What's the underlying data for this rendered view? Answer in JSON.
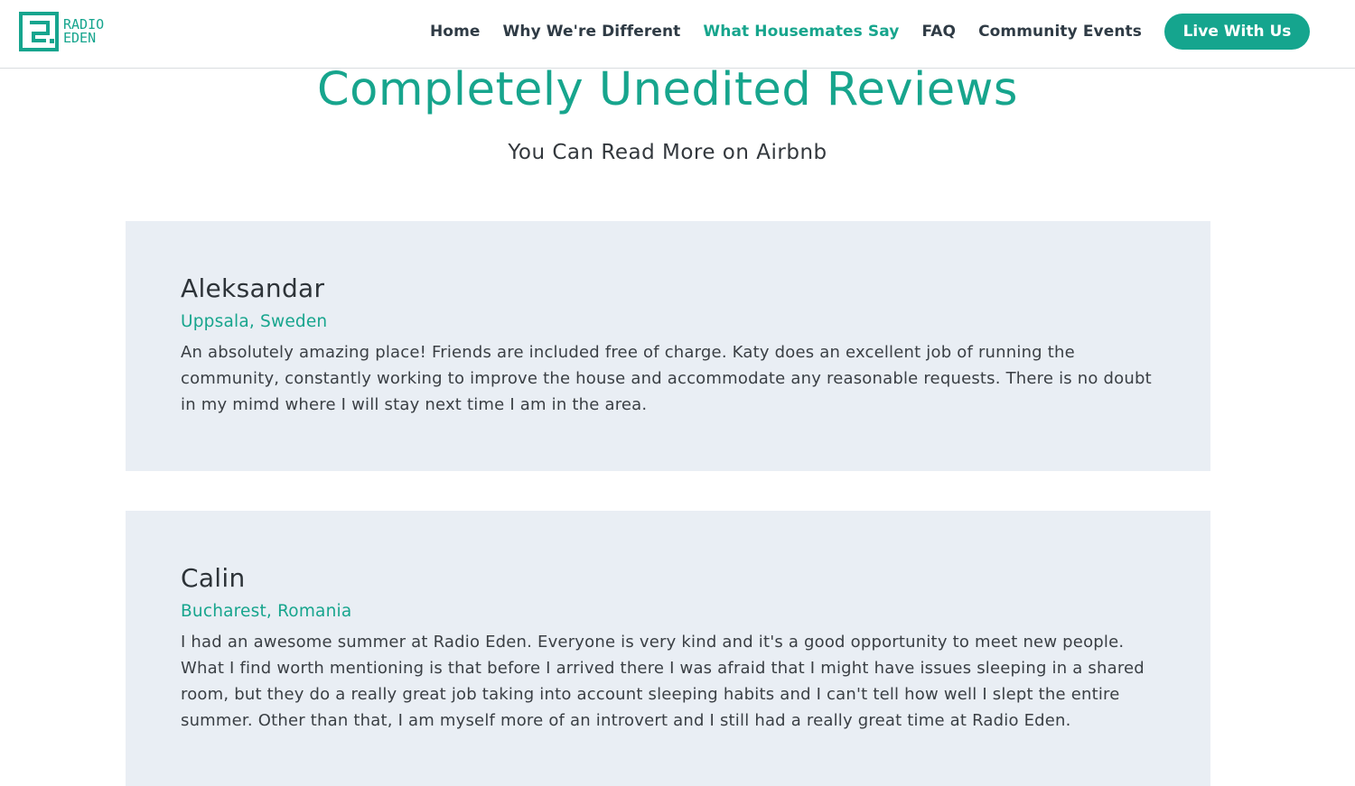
{
  "brand": {
    "logo_line1": "RADIO",
    "logo_line2": "EDEN",
    "accent_color": "#15a58e"
  },
  "nav": {
    "items": [
      {
        "label": "Home",
        "active": false
      },
      {
        "label": "Why We're Different",
        "active": false
      },
      {
        "label": "What Housemates Say",
        "active": true
      },
      {
        "label": "FAQ",
        "active": false
      },
      {
        "label": "Community Events",
        "active": false
      }
    ],
    "cta_label": "Live With Us"
  },
  "hero": {
    "title": "Completely Unedited Reviews",
    "subtitle": "You Can Read More on Airbnb"
  },
  "reviews": [
    {
      "name": "Aleksandar",
      "location": "Uppsala, Sweden",
      "text": "An absolutely amazing place! Friends are included free of charge. Katy does an excellent job of running the community, constantly working to improve the house and accommodate any reasonable requests. There is no doubt in my mimd where I will stay next time I am in the area."
    },
    {
      "name": "Calin",
      "location": "Bucharest, Romania",
      "text": "I had an awesome summer at Radio Eden. Everyone is very kind and it's a good opportunity to meet new people. What I find worth mentioning is that before I arrived there I was afraid that I might have issues sleeping in a shared room, but they do a really great job taking into account sleeping habits and I can't tell how well I slept the entire summer. Other than that, I am myself more of an introvert and I still had a really great time at Radio Eden."
    }
  ]
}
